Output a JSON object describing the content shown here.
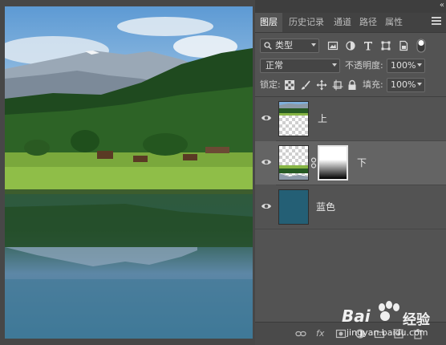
{
  "panel": {
    "collapse_glyph": "«",
    "tabs": [
      "图层",
      "历史记录",
      "通道",
      "路径",
      "属性"
    ],
    "active_tab": 0,
    "filter": {
      "kind_label": "类型",
      "icons": [
        "image-filter-icon",
        "adjustment-filter-icon",
        "type-filter-icon",
        "shape-filter-icon",
        "smart-object-filter-icon",
        "filter-toggle-icon"
      ]
    },
    "blend_mode": "正常",
    "opacity_label": "不透明度:",
    "opacity_value": "100%",
    "lock_label": "锁定:",
    "fill_label": "填充:",
    "fill_value": "100%",
    "layers": [
      {
        "name": "上",
        "visible": true,
        "selected": false,
        "has_mask": false
      },
      {
        "name": "下",
        "visible": true,
        "selected": true,
        "has_mask": true
      },
      {
        "name": "蓝色",
        "visible": true,
        "selected": false,
        "has_mask": false,
        "fill_color": "#245f75"
      }
    ],
    "bottom_icons": [
      "link-layers-icon",
      "fx-icon",
      "add-mask-icon",
      "adjustment-layer-icon",
      "new-group-icon",
      "new-layer-icon",
      "delete-layer-icon"
    ],
    "fx_label": "fx"
  },
  "watermark": {
    "brand": "Bai",
    "brand_cn": "经验",
    "url": "jingyan.baidu.com"
  },
  "colors": {
    "panel_bg": "#535353",
    "selected_layer": "#646464",
    "layer_fill": "#245f75"
  }
}
